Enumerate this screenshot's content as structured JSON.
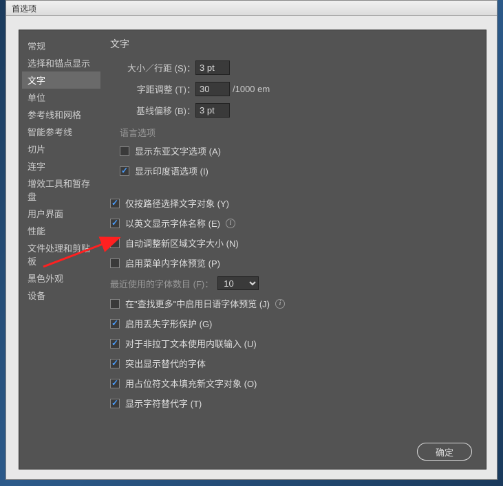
{
  "window": {
    "title": "首选项"
  },
  "sidebar": {
    "items": [
      "常规",
      "选择和锚点显示",
      "文字",
      "单位",
      "参考线和网格",
      "智能参考线",
      "切片",
      "连字",
      "增效工具和暂存盘",
      "用户界面",
      "性能",
      "文件处理和剪贴板",
      "黑色外观",
      "设备"
    ],
    "selected_index": 2
  },
  "main": {
    "title": "文字",
    "size_leading": {
      "label": "大小／行距 (S)：",
      "value": "3 pt"
    },
    "tracking": {
      "label": "字距调整 (T)：",
      "value": "30",
      "suffix": "/1000 em"
    },
    "baseline": {
      "label": "基线偏移 (B)：",
      "value": "3 pt"
    },
    "lang_group": "语言选项",
    "chk_east_asian": {
      "label": "显示东亚文字选项 (A)",
      "checked": false
    },
    "chk_indic": {
      "label": "显示印度语选项 (I)",
      "checked": true
    },
    "chk_path_only": {
      "label": "仅按路径选择文字对象 (Y)",
      "checked": true
    },
    "chk_english_font": {
      "label": "以英文显示字体名称 (E)",
      "checked": true
    },
    "chk_auto_size": {
      "label": "自动调整新区域文字大小 (N)",
      "checked": false
    },
    "chk_menu_preview": {
      "label": "启用菜单内字体预览 (P)",
      "checked": false
    },
    "recent_fonts": {
      "label": "最近使用的字体数目 (F)：",
      "value": "10"
    },
    "chk_jp_preview": {
      "label": "在\"查找更多\"中启用日语字体预览 (J)",
      "checked": false
    },
    "chk_missing_glyph": {
      "label": "启用丢失字形保护 (G)",
      "checked": true
    },
    "chk_inline_input": {
      "label": "对于非拉丁文本使用内联输入 (U)",
      "checked": true
    },
    "chk_highlight_alt": {
      "label": "突出显示替代的字体",
      "checked": true
    },
    "chk_placeholder": {
      "label": "用占位符文本填充新文字对象 (O)",
      "checked": true
    },
    "chk_alt_glyph": {
      "label": "显示字符替代字 (T)",
      "checked": true
    }
  },
  "buttons": {
    "ok": "确定"
  }
}
